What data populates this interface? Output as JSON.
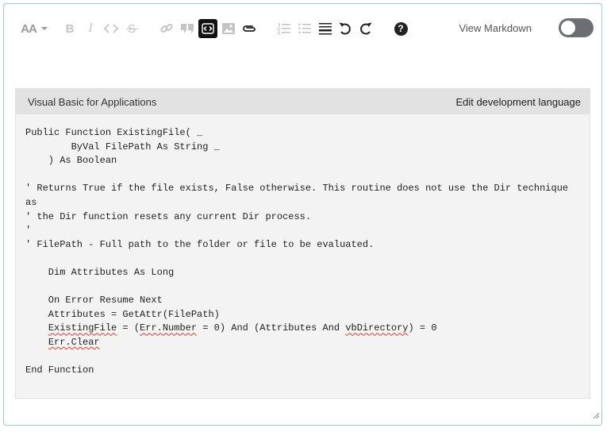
{
  "toolbar": {
    "buttons": [
      {
        "name": "heading-icon",
        "label": "AA"
      },
      {
        "name": "heading-dropdown-icon"
      },
      {
        "name": "bold-icon",
        "label": "B"
      },
      {
        "name": "italic-icon",
        "label": "I"
      },
      {
        "name": "inline-code-icon"
      },
      {
        "name": "strikethrough-icon",
        "label": "S"
      },
      {
        "name": "link-icon"
      },
      {
        "name": "blockquote-icon"
      },
      {
        "name": "code-block-icon"
      },
      {
        "name": "image-icon"
      },
      {
        "name": "attachment-icon"
      },
      {
        "name": "ordered-list-icon"
      },
      {
        "name": "bullet-list-icon"
      },
      {
        "name": "horizontal-rule-icon"
      },
      {
        "name": "undo-icon"
      },
      {
        "name": "redo-icon"
      },
      {
        "name": "help-icon",
        "label": "?"
      }
    ],
    "view_markdown_label": "View Markdown",
    "view_markdown_on": false
  },
  "code_block": {
    "language": "Visual Basic for Applications",
    "edit_language_label": "Edit development language",
    "lines": [
      [
        {
          "t": "Public Function ExistingFile( _"
        }
      ],
      [
        {
          "t": "        ByVal FilePath As String _"
        }
      ],
      [
        {
          "t": "    ) As Boolean"
        }
      ],
      [],
      [
        {
          "t": "' Returns True if the file exists, False otherwise. This routine does not use the Dir technique"
        }
      ],
      [
        {
          "t": "as"
        }
      ],
      [
        {
          "t": "' the Dir function resets any current Dir process."
        }
      ],
      [
        {
          "t": "'"
        }
      ],
      [
        {
          "t": "' FilePath - Full path to the folder or file to be evaluated."
        }
      ],
      [],
      [
        {
          "t": "    Dim Attributes As Long"
        }
      ],
      [],
      [
        {
          "t": "    On Error Resume Next"
        }
      ],
      [
        {
          "t": "    Attributes = GetAttr(FilePath)"
        }
      ],
      [
        {
          "t": "    "
        },
        {
          "t": "ExistingFile",
          "err": true
        },
        {
          "t": " = ("
        },
        {
          "t": "Err.Number",
          "err": true
        },
        {
          "t": " = 0) And (Attributes And "
        },
        {
          "t": "vbDirectory",
          "err": true
        },
        {
          "t": ") = 0"
        }
      ],
      [
        {
          "t": "    "
        },
        {
          "t": "Err.Clear",
          "err": true
        }
      ],
      [],
      [
        {
          "t": "End Function"
        }
      ]
    ]
  },
  "colors": {
    "icon_disabled": "#bbbbbb",
    "icon_enabled": "#222222",
    "toggle_off": "#6b6f74",
    "spellcheck_underline": "#e53935",
    "editor_border": "#9ec6e6"
  }
}
